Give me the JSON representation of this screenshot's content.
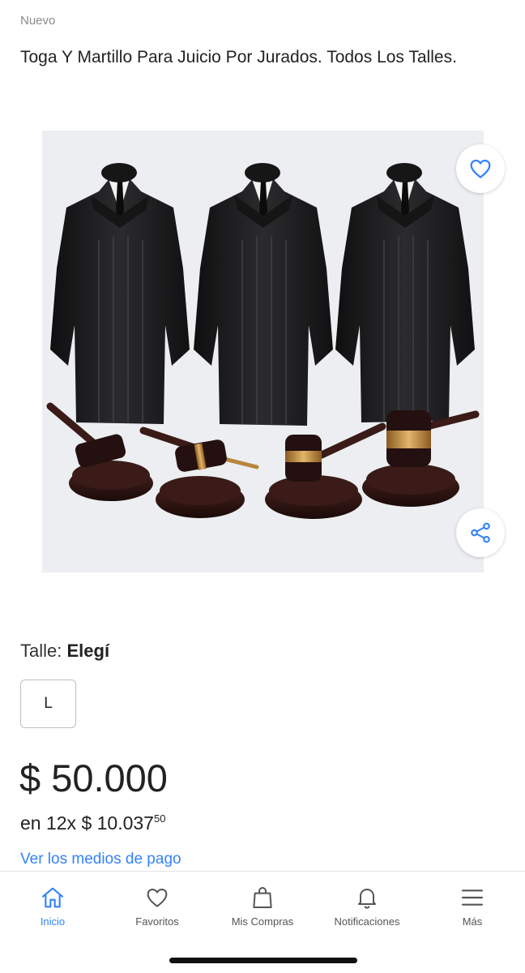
{
  "product": {
    "condition": "Nuevo",
    "title": "Toga Y Martillo Para Juicio Por Jurados. Todos Los Talles.",
    "image_alt": "Togas negras y martillos de juez"
  },
  "variations": {
    "size_label": "Talle:",
    "size_value": "Elegí",
    "options": [
      "L"
    ]
  },
  "pricing": {
    "price": "$ 50.000",
    "installments_prefix": "en 12x $ 10.037",
    "installments_cents": "50",
    "payment_link": "Ver los medios de pago"
  },
  "bottom_nav": {
    "items": [
      {
        "label": "Inicio",
        "icon": "home-icon",
        "active": true
      },
      {
        "label": "Favoritos",
        "icon": "heart-icon",
        "active": false
      },
      {
        "label": "Mis Compras",
        "icon": "shopping-bag-icon",
        "active": false
      },
      {
        "label": "Notificaciones",
        "icon": "bell-icon",
        "active": false
      },
      {
        "label": "Más",
        "icon": "menu-icon",
        "active": false
      }
    ]
  },
  "colors": {
    "accent": "#3483fa",
    "robe": "#1c1c1e",
    "wood": "#2a1412",
    "brass": "#b8863b"
  }
}
